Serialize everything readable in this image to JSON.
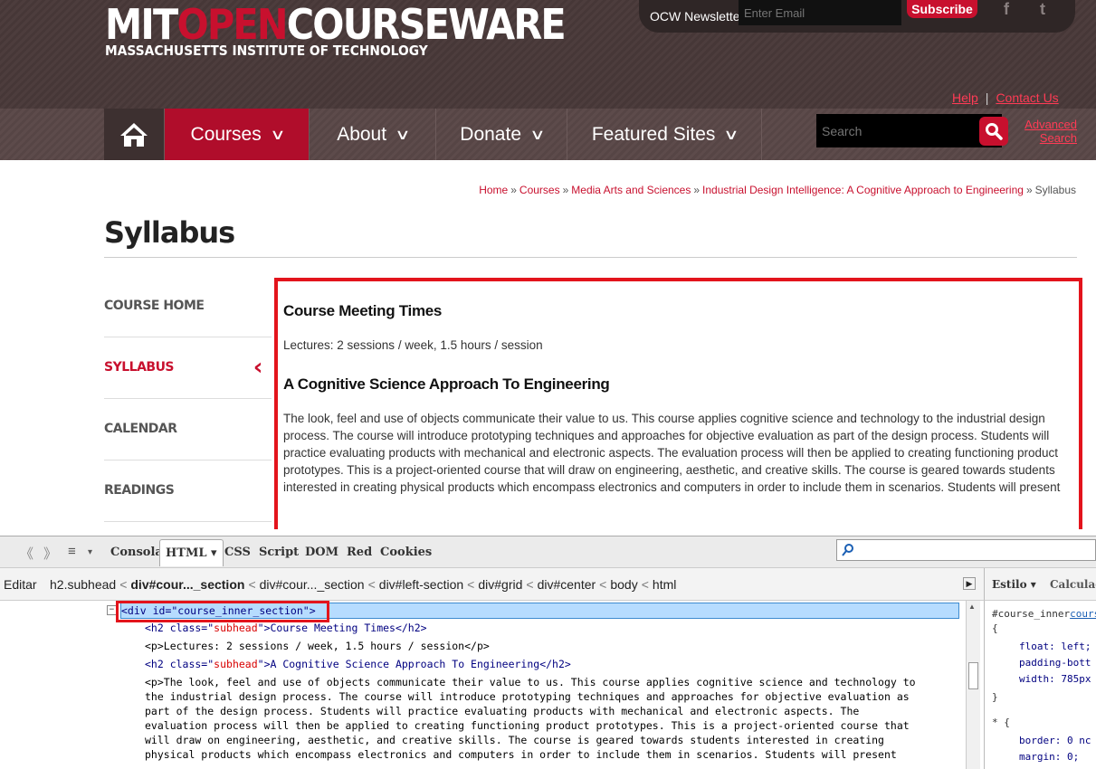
{
  "header": {
    "logo": {
      "mit": "MIT",
      "open": "OPEN",
      "courseware": "COURSEWARE",
      "subtitle": "MASSACHUSETTS INSTITUTE OF TECHNOLOGY"
    },
    "newsletter": {
      "label": "OCW Newsletter",
      "email_placeholder": "Enter Email",
      "subscribe": "Subscribe",
      "facebook": "f",
      "twitter": "t"
    },
    "help": "Help",
    "separator": "|",
    "contact": "Contact Us"
  },
  "nav": {
    "home_icon": "home-icon",
    "items": [
      {
        "label": "Courses",
        "chevron": "∨"
      },
      {
        "label": "About",
        "chevron": "∨"
      },
      {
        "label": "Donate",
        "chevron": "∨"
      },
      {
        "label": "Featured Sites",
        "chevron": "∨"
      }
    ],
    "search_placeholder": "Search",
    "advanced_line1": "Advanced",
    "advanced_line2": "Search",
    "accent": "#c8102e"
  },
  "breadcrumb": {
    "items": [
      "Home",
      "Courses",
      "Media Arts and Sciences",
      "Industrial Design Intelligence: A Cognitive Approach to Engineering"
    ],
    "current": "Syllabus",
    "separator": "»"
  },
  "page": {
    "title": "Syllabus"
  },
  "sidenav": {
    "items": [
      "COURSE HOME",
      "SYLLABUS",
      "CALENDAR",
      "READINGS"
    ],
    "active_arrow": "‹"
  },
  "content": {
    "h1": "Course Meeting Times",
    "p1": "Lectures: 2 sessions / week, 1.5 hours / session",
    "h2": "A Cognitive Science Approach To Engineering",
    "p2": "The look, feel and use of objects communicate their value to us. This course applies cognitive science and technology to the industrial design process. The course will introduce prototyping techniques and approaches for objective evaluation as part of the design process. Students will practice evaluating products with mechanical and electronic aspects. The evaluation process will then be applied to creating functioning product prototypes. This is a project-oriented course that will draw on engineering, aesthetic, and creative skills. The course is geared towards students interested in creating physical products which encompass electronics and computers in order to include them in scenarios. Students will present"
  },
  "firebug": {
    "tabs": [
      "Consola",
      "HTML ▾",
      "CSS",
      "Script",
      "DOM",
      "Red",
      "Cookies"
    ],
    "edit": "Editar",
    "crumbs": {
      "c1": "h2.subhead",
      "c2": "div#cour..._section",
      "c3": "div#cour..._section",
      "c4": "div#left-section",
      "c5": "div#grid",
      "c6": "div#center",
      "c7": "body",
      "c8": "html",
      "sep": "<"
    },
    "code": {
      "l0": "<div id=\"course_inner_section\">",
      "l1a": "<h2 class=\"",
      "l1b": "subhead",
      "l1c": "\">Course Meeting Times</h2>",
      "l2": "<p>Lectures: 2 sessions / week, 1.5 hours / session</p>",
      "l3a": "<h2 class=\"",
      "l3b": "subhead",
      "l3c": "\">A Cognitive Science Approach To Engineering</h2>",
      "l4": "<p>The look, feel and use of objects communicate their value to us. This course applies cognitive science and technology to",
      "l5": "the industrial design process. The course will introduce prototyping techniques and approaches for objective evaluation as",
      "l6": "part of the design process. Students will practice evaluating products with mechanical and electronic aspects. The",
      "l7": "evaluation process will then be applied to creating functioning product prototypes. This is a project-oriented course that",
      "l8": "will draw on engineering, aesthetic, and creative skills. The course is geared towards students interested in creating",
      "l9": "physical products which encompass electronics and computers in order to include them in scenarios. Students will present"
    },
    "right": {
      "tab1": "Estilo ▾",
      "tab2": "Calculado",
      "r0": "#course_inner",
      "r0b": "cours",
      "r1": "{",
      "r2": "float: left;",
      "r3": "padding-bott",
      "r4": "width: 785px",
      "r5": "}",
      "r6": "* {",
      "r7": "border: 0 nc",
      "r8": "margin: 0;"
    }
  }
}
